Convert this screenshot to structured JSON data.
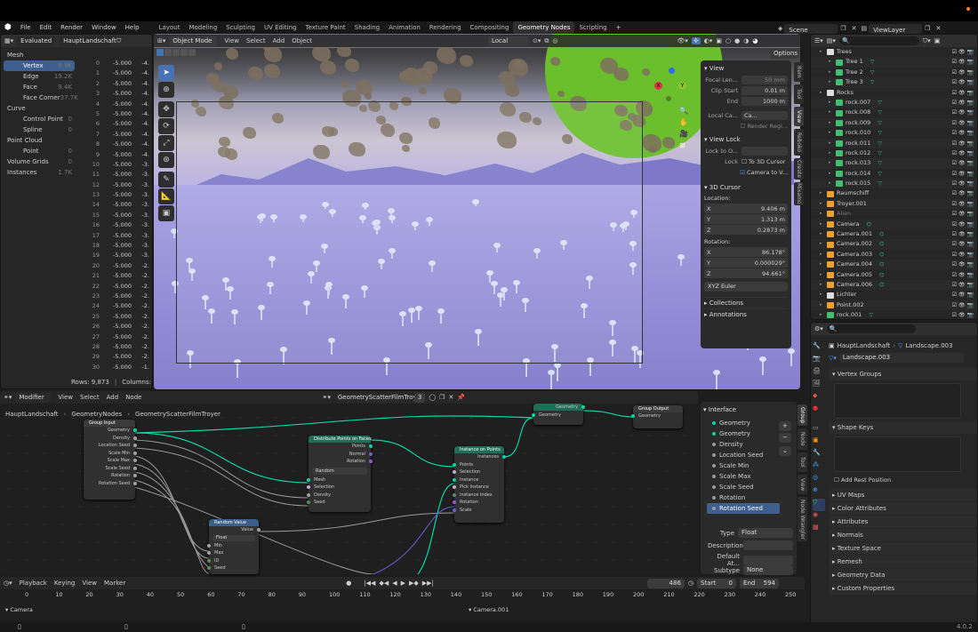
{
  "menu": {
    "items": [
      "File",
      "Edit",
      "Render",
      "Window",
      "Help"
    ]
  },
  "workspaces": [
    "Layout",
    "Modeling",
    "Sculpting",
    "UV Editing",
    "Texture Paint",
    "Shading",
    "Animation",
    "Rendering",
    "Compositing",
    "Geometry Nodes",
    "Scripting"
  ],
  "active_workspace": "Geometry Nodes",
  "scene": "Scene",
  "view_layer": "ViewLayer",
  "spreadsheet": {
    "mode": "Evaluated",
    "object": "HauptLandschaft",
    "domains": [
      {
        "label": "Mesh",
        "count": ""
      },
      {
        "label": "Vertex",
        "count": "9.9K"
      },
      {
        "label": "Edge",
        "count": "19.2K"
      },
      {
        "label": "Face",
        "count": "9.4K"
      },
      {
        "label": "Face Corner",
        "count": "37.7K"
      },
      {
        "label": "Curve",
        "count": ""
      },
      {
        "label": "Control Point",
        "count": "0"
      },
      {
        "label": "Spline",
        "count": "0"
      },
      {
        "label": "Point Cloud",
        "count": ""
      },
      {
        "label": "Point",
        "count": "0"
      },
      {
        "label": "Volume Grids",
        "count": "0"
      },
      {
        "label": "Instances",
        "count": "1.7K"
      }
    ],
    "rows": [
      [
        "0",
        "-5.000",
        "-4."
      ],
      [
        "1",
        "-5.000",
        "-4."
      ],
      [
        "2",
        "-5.000",
        "-4."
      ],
      [
        "3",
        "-5.000",
        "-4."
      ],
      [
        "4",
        "-5.000",
        "-4."
      ],
      [
        "5",
        "-5.000",
        "-4."
      ],
      [
        "6",
        "-5.000",
        "-4."
      ],
      [
        "7",
        "-5.000",
        "-4."
      ],
      [
        "8",
        "-5.000",
        "-4."
      ],
      [
        "9",
        "-5.000",
        "-4."
      ],
      [
        "10",
        "-5.000",
        "-3."
      ],
      [
        "11",
        "-5.000",
        "-3."
      ],
      [
        "12",
        "-5.000",
        "-3."
      ],
      [
        "13",
        "-5.000",
        "-3."
      ],
      [
        "14",
        "-5.000",
        "-3."
      ],
      [
        "15",
        "-5.000",
        "-3."
      ],
      [
        "16",
        "-5.000",
        "-3."
      ],
      [
        "17",
        "-5.000",
        "-3."
      ],
      [
        "18",
        "-5.000",
        "-3."
      ],
      [
        "19",
        "-5.000",
        "-3."
      ],
      [
        "20",
        "-5.000",
        "-2."
      ],
      [
        "21",
        "-5.000",
        "-2."
      ],
      [
        "22",
        "-5.000",
        "-2."
      ],
      [
        "23",
        "-5.000",
        "-2."
      ],
      [
        "24",
        "-5.000",
        "-2."
      ],
      [
        "25",
        "-5.000",
        "-2."
      ],
      [
        "26",
        "-5.000",
        "-2."
      ],
      [
        "27",
        "-5.000",
        "-2."
      ],
      [
        "28",
        "-5.000",
        "-2."
      ],
      [
        "29",
        "-5.000",
        "-2."
      ],
      [
        "30",
        "-5.000",
        "-1."
      ]
    ],
    "footer_rows": "Rows: 9,873",
    "footer_cols": "Columns: 1"
  },
  "viewport": {
    "mode": "Object Mode",
    "menus": [
      "View",
      "Select",
      "Add",
      "Object"
    ],
    "orientation": "Local",
    "options": "Options"
  },
  "npanel": {
    "view_header": "View",
    "focal_label": "Focal Len...",
    "focal_value": "50 mm",
    "clip_start_label": "Clip Start",
    "clip_start": "0.01 m",
    "clip_end_label": "End",
    "clip_end": "1000 m",
    "local_camera": "Local Ca...",
    "camera_btn": "Ca...",
    "render_region": "Render Regi...",
    "viewlock_header": "View Lock",
    "lock_to_obj": "Lock to O...",
    "lock_label": "Lock",
    "to_cursor": "To 3D Cursor",
    "cam_to_view": "Camera to V...",
    "cursor_header": "3D Cursor",
    "location": "Location:",
    "loc": [
      [
        "X",
        "9.406 m"
      ],
      [
        "Y",
        "1.313 m"
      ],
      [
        "Z",
        "0.2873 m"
      ]
    ],
    "rotation": "Rotation:",
    "rot": [
      [
        "X",
        "86.178°"
      ],
      [
        "Y",
        "0.000029°"
      ],
      [
        "Z",
        "94.661°"
      ]
    ],
    "euler": "XYZ Euler",
    "collections": "Collections",
    "annotations": "Annotations",
    "tabs": [
      "Item",
      "Tool",
      "View",
      "Reboko",
      "Create",
      "Mixamo"
    ]
  },
  "outliner": {
    "rows": [
      {
        "name": "Trees",
        "depth": 0,
        "type": "coll"
      },
      {
        "name": "Tree 1",
        "depth": 1,
        "type": "mesh"
      },
      {
        "name": "Tree 2",
        "depth": 1,
        "type": "mesh"
      },
      {
        "name": "Tree 3",
        "depth": 1,
        "type": "mesh"
      },
      {
        "name": "Rocks",
        "depth": 0,
        "type": "coll"
      },
      {
        "name": "rock.007",
        "depth": 1,
        "type": "mesh"
      },
      {
        "name": "rock.008",
        "depth": 1,
        "type": "mesh"
      },
      {
        "name": "rock.009",
        "depth": 1,
        "type": "mesh"
      },
      {
        "name": "rock.010",
        "depth": 1,
        "type": "mesh"
      },
      {
        "name": "rock.011",
        "depth": 1,
        "type": "mesh"
      },
      {
        "name": "rock.012",
        "depth": 1,
        "type": "mesh"
      },
      {
        "name": "rock.013",
        "depth": 1,
        "type": "mesh"
      },
      {
        "name": "rock.014",
        "depth": 1,
        "type": "mesh"
      },
      {
        "name": "rock.015",
        "depth": 1,
        "type": "mesh"
      },
      {
        "name": "Raumschiff",
        "depth": 0,
        "type": "obj"
      },
      {
        "name": "Troyer.001",
        "depth": 0,
        "type": "obj"
      },
      {
        "name": "Alien",
        "depth": 0,
        "type": "obj"
      },
      {
        "name": "Camera",
        "depth": 0,
        "type": "cam"
      },
      {
        "name": "Camera.001",
        "depth": 0,
        "type": "cam"
      },
      {
        "name": "Camera.002",
        "depth": 0,
        "type": "cam"
      },
      {
        "name": "Camera.003",
        "depth": 0,
        "type": "cam"
      },
      {
        "name": "Camera.004",
        "depth": 0,
        "type": "cam"
      },
      {
        "name": "Camera.005",
        "depth": 0,
        "type": "cam"
      },
      {
        "name": "Camera.006",
        "depth": 0,
        "type": "cam"
      },
      {
        "name": "Lichter",
        "depth": 0,
        "type": "coll"
      },
      {
        "name": "Point.002",
        "depth": 0,
        "type": "light"
      },
      {
        "name": "rock.001",
        "depth": 0,
        "type": "mesh"
      }
    ]
  },
  "properties": {
    "object": "HauptLandschaft",
    "data": "Landscape.003",
    "mesh_name": "Landscape.003",
    "vertex_groups": "Vertex Groups",
    "shape_keys": "Shape Keys",
    "add_rest": "Add Rest Position",
    "sections": [
      "UV Maps",
      "Color Attributes",
      "Attributes",
      "Normals",
      "Texture Space",
      "Remesh",
      "Geometry Data",
      "Custom Properties"
    ]
  },
  "nodes": {
    "editor_menus": [
      "Modifier",
      "View",
      "Select",
      "Add",
      "Node"
    ],
    "tree": "GeometryScatterFilmTroyer",
    "users": "3",
    "breadcrumb": [
      "HauptLandschaft",
      "GeometryNodes",
      "GeometryScatterFilmTroyer"
    ],
    "group_input": {
      "title": "Group Input",
      "outputs": [
        "Geometry",
        "Density",
        "Location Seed",
        "Scale Min",
        "Scale Max",
        "Scale Seed",
        "Rotation",
        "Rotation Seed"
      ]
    },
    "distribute": {
      "title": "Distribute Points on Faces",
      "outputs": [
        "Points",
        "Normal",
        "Rotation"
      ],
      "mode": "Random",
      "inputs": [
        "Mesh",
        "Selection",
        "Density",
        "Seed"
      ]
    },
    "instance": {
      "title": "Instance on Points",
      "outputs": [
        "Instances"
      ],
      "inputs": [
        "Points",
        "Selection",
        "Instance",
        "Pick Instance",
        "Instance Index",
        "Rotation",
        "Scale"
      ]
    },
    "random": {
      "title": "Random Value",
      "output": "Value",
      "type": "Float",
      "inputs": [
        "Min",
        "Max",
        "ID",
        "Seed"
      ]
    },
    "group_output": {
      "title": "Group Output",
      "inputs": [
        "Geometry"
      ]
    },
    "geo_node": {
      "label": "Geometry"
    },
    "interface": {
      "header": "Interface",
      "items": [
        "Geometry",
        "Geometry",
        "Density",
        "Location Seed",
        "Scale Min",
        "Scale Max",
        "Scale Seed",
        "Rotation",
        "Rotation Seed"
      ],
      "type_label": "Type",
      "type": "Float",
      "desc_label": "Description",
      "default_label": "Default At...",
      "subtype_label": "Subtype",
      "subtype": "None"
    },
    "tabs": [
      "Group",
      "Node",
      "Tool",
      "View",
      "Node Wrangler"
    ]
  },
  "timeline": {
    "menus": [
      "Playback",
      "Keying",
      "View",
      "Marker"
    ],
    "frame": "486",
    "start_label": "Start",
    "start": "0",
    "end_label": "End",
    "end": "594",
    "ticks": [
      "0",
      "10",
      "20",
      "30",
      "40",
      "50",
      "60",
      "70",
      "80",
      "90",
      "100",
      "110",
      "120",
      "130",
      "140",
      "150",
      "160",
      "170",
      "180",
      "190",
      "200",
      "210",
      "220",
      "230",
      "240",
      "250"
    ],
    "markers": [
      "Camera",
      "Camera.001"
    ]
  },
  "status": {
    "version": "4.0.2"
  }
}
